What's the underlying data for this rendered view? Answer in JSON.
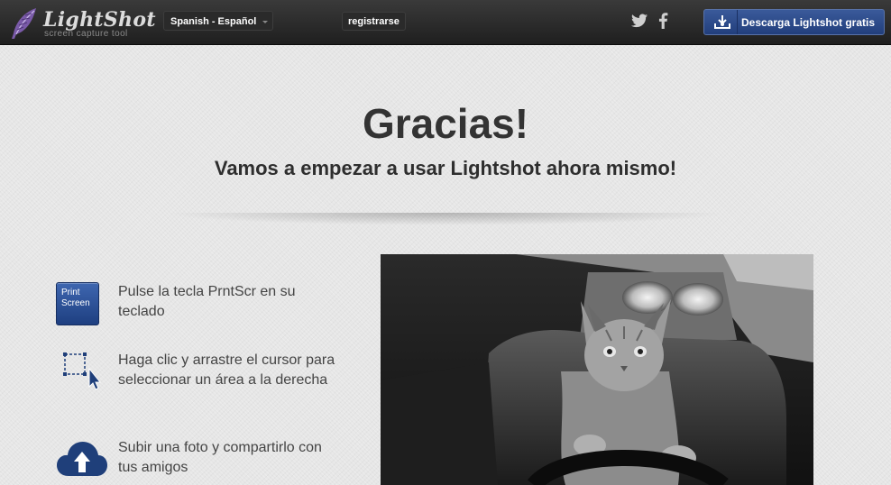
{
  "header": {
    "logo_name": "LightShot",
    "logo_tagline": "screen capture tool",
    "language": "Spanish - Español",
    "register": "registrarse",
    "social": [
      "twitter-icon",
      "facebook-icon"
    ],
    "download_button": "Descarga Lightshot gratis"
  },
  "hero": {
    "title": "Gracias!",
    "subtitle": "Vamos a empezar a usar Lightshot ahora mismo!"
  },
  "steps": [
    {
      "icon": "print-screen-key-icon",
      "key_label_1": "Print",
      "key_label_2": "Screen",
      "text": "Pulse la tecla PrntScr en su teclado"
    },
    {
      "icon": "selection-cursor-icon",
      "text": "Haga clic y arrastre el cursor para seleccionar un área a la derecha"
    },
    {
      "icon": "cloud-upload-icon",
      "text": "Subir una foto y compartirlo con tus amigos"
    }
  ],
  "colors": {
    "topbar": "#2b2b2b",
    "accent_blue": "#2a4a8c",
    "background": "#e6e6e6"
  }
}
